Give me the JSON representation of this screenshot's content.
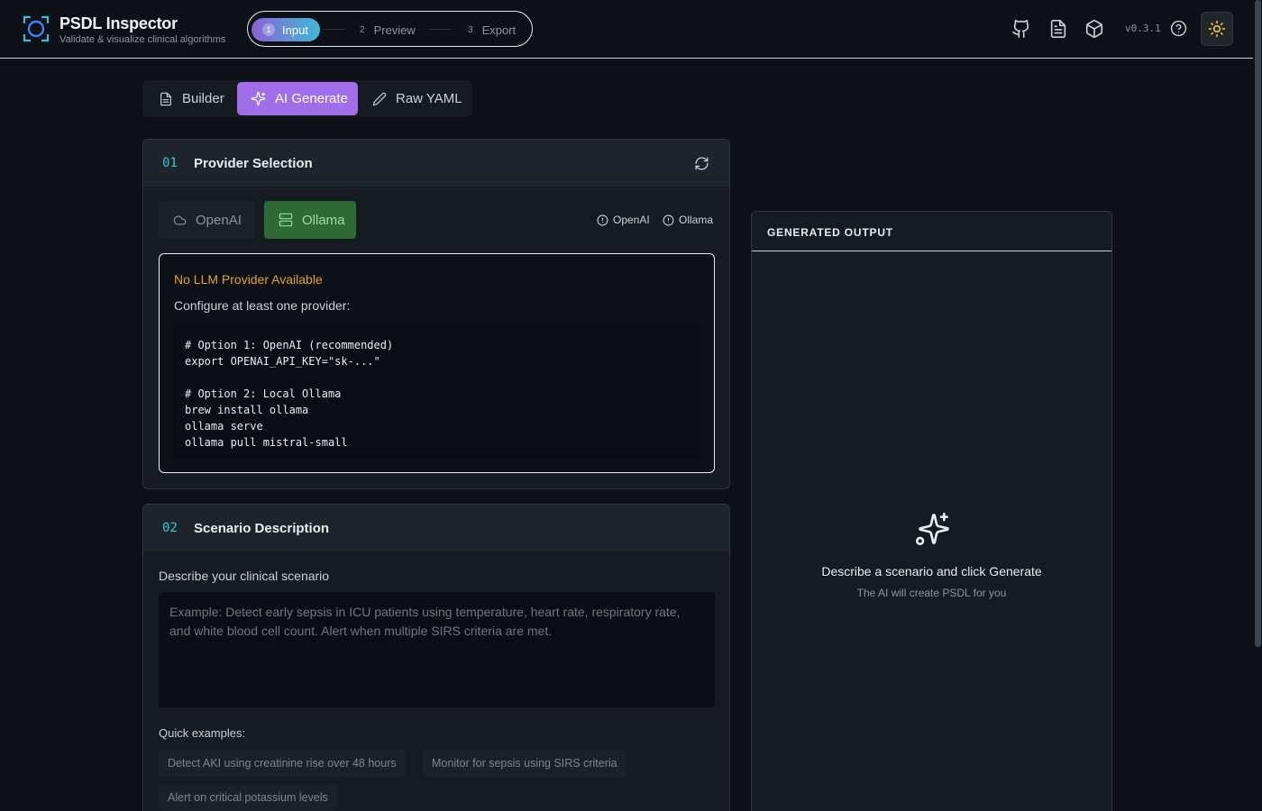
{
  "app": {
    "title": "PSDL Inspector",
    "subtitle": "Validate & visualize clinical algorithms",
    "version": "v0.3.1"
  },
  "stepper": {
    "steps": [
      {
        "num": "1",
        "label": "Input",
        "active": true
      },
      {
        "num": "2",
        "label": "Preview",
        "active": false
      },
      {
        "num": "3",
        "label": "Export",
        "active": false
      }
    ]
  },
  "header_icons": [
    "github-icon",
    "docs-icon",
    "package-icon",
    "help-icon",
    "sun-icon"
  ],
  "tabs": [
    {
      "label": "Builder",
      "icon": "document-icon",
      "active": false
    },
    {
      "label": "AI Generate",
      "icon": "sparkles-icon",
      "active": true
    },
    {
      "label": "Raw YAML",
      "icon": "pencil-icon",
      "active": false
    }
  ],
  "provider_panel": {
    "num": "01",
    "title": "Provider Selection",
    "providers": [
      {
        "label": "OpenAI",
        "icon": "cloud-icon",
        "selected": false
      },
      {
        "label": "Ollama",
        "icon": "server-icon",
        "selected": true
      }
    ],
    "statuses": [
      "OpenAI",
      "Ollama"
    ],
    "warning": {
      "title": "No LLM Provider Available",
      "subtitle": "Configure at least one provider:",
      "code": [
        "# Option 1: OpenAI (recommended)",
        "export OPENAI_API_KEY=\"sk-...\"",
        "",
        "# Option 2: Local Ollama",
        "brew install ollama",
        "ollama serve",
        "ollama pull mistral-small"
      ]
    }
  },
  "scenario_panel": {
    "num": "02",
    "title": "Scenario Description",
    "label": "Describe your clinical scenario",
    "placeholder": "Example: Detect early sepsis in ICU patients using temperature, heart rate, respiratory rate, and white blood cell count. Alert when multiple SIRS criteria are met.",
    "quick_label": "Quick examples:",
    "quick_examples": [
      "Detect AKI using creatinine rise over 48 hours",
      "Monitor for sepsis using SIRS criteria",
      "Alert on critical potassium levels"
    ]
  },
  "output": {
    "title": "GENERATED OUTPUT",
    "empty_title": "Describe a scenario and click Generate",
    "empty_sub": "The AI will create PSDL for you"
  },
  "colors": {
    "background": "#0d1117",
    "accent_purple": "#a06ee8",
    "accent_cyan": "#39c5cf",
    "ollama_green": "#2d6a35",
    "warning": "#e3a32b"
  }
}
